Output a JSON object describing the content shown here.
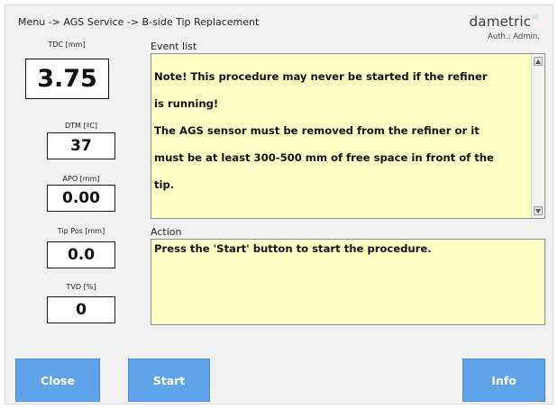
{
  "header": {
    "breadcrumb": "Menu -> AGS Service -> B-side Tip Replacement",
    "brand": "dametric",
    "brand_mark": "III",
    "auth": "Auth.: Admin."
  },
  "gauges": [
    {
      "label": "TDC [mm]",
      "value": "3.75"
    },
    {
      "label": "DTM [ºC]",
      "value": "37"
    },
    {
      "label": "APO [mm]",
      "value": "0.00"
    },
    {
      "label": "Tip Pos [mm]",
      "value": "0.0"
    },
    {
      "label": "TVD [%]",
      "value": "0"
    }
  ],
  "event_list": {
    "label": "Event list",
    "lines": [
      "Note! This procedure may never be started if the refiner",
      "is running!",
      "The AGS sensor must be removed from the refiner or it",
      "must be at least 300-500 mm of free space in front of the",
      "tip."
    ]
  },
  "action": {
    "label": "Action",
    "text": "Press the 'Start' button to start the procedure."
  },
  "buttons": {
    "close": "Close",
    "start": "Start",
    "info": "Info"
  },
  "colors": {
    "panel_bg": "#ffffc5",
    "button_bg": "#5fa4ea",
    "frame_bg": "#f1f1f1"
  },
  "icons": {
    "scroll_up": "triangle-up-icon",
    "scroll_down": "triangle-down-icon"
  }
}
